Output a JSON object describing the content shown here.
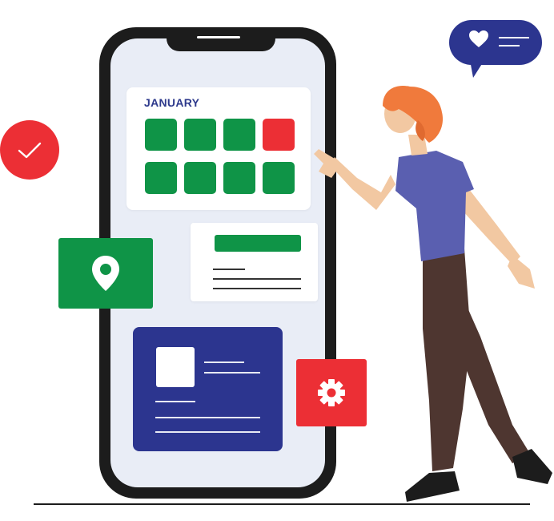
{
  "calendar": {
    "month": "JANUARY",
    "days": [
      {
        "status": "available"
      },
      {
        "status": "available"
      },
      {
        "status": "available"
      },
      {
        "status": "busy"
      },
      {
        "status": "available"
      },
      {
        "status": "available"
      },
      {
        "status": "available"
      },
      {
        "status": "available"
      }
    ]
  },
  "icons": {
    "check": "check-icon",
    "location": "location-pin-icon",
    "settings": "gear-icon",
    "favorite": "heart-icon"
  },
  "colors": {
    "green": "#0f9447",
    "red": "#ec2f35",
    "navy": "#2c358f",
    "screen": "#e9edf6",
    "phone": "#1c1c1c",
    "shirt": "#5a5fb0",
    "trousers": "#4e3630",
    "hair": "#f07a3c"
  }
}
